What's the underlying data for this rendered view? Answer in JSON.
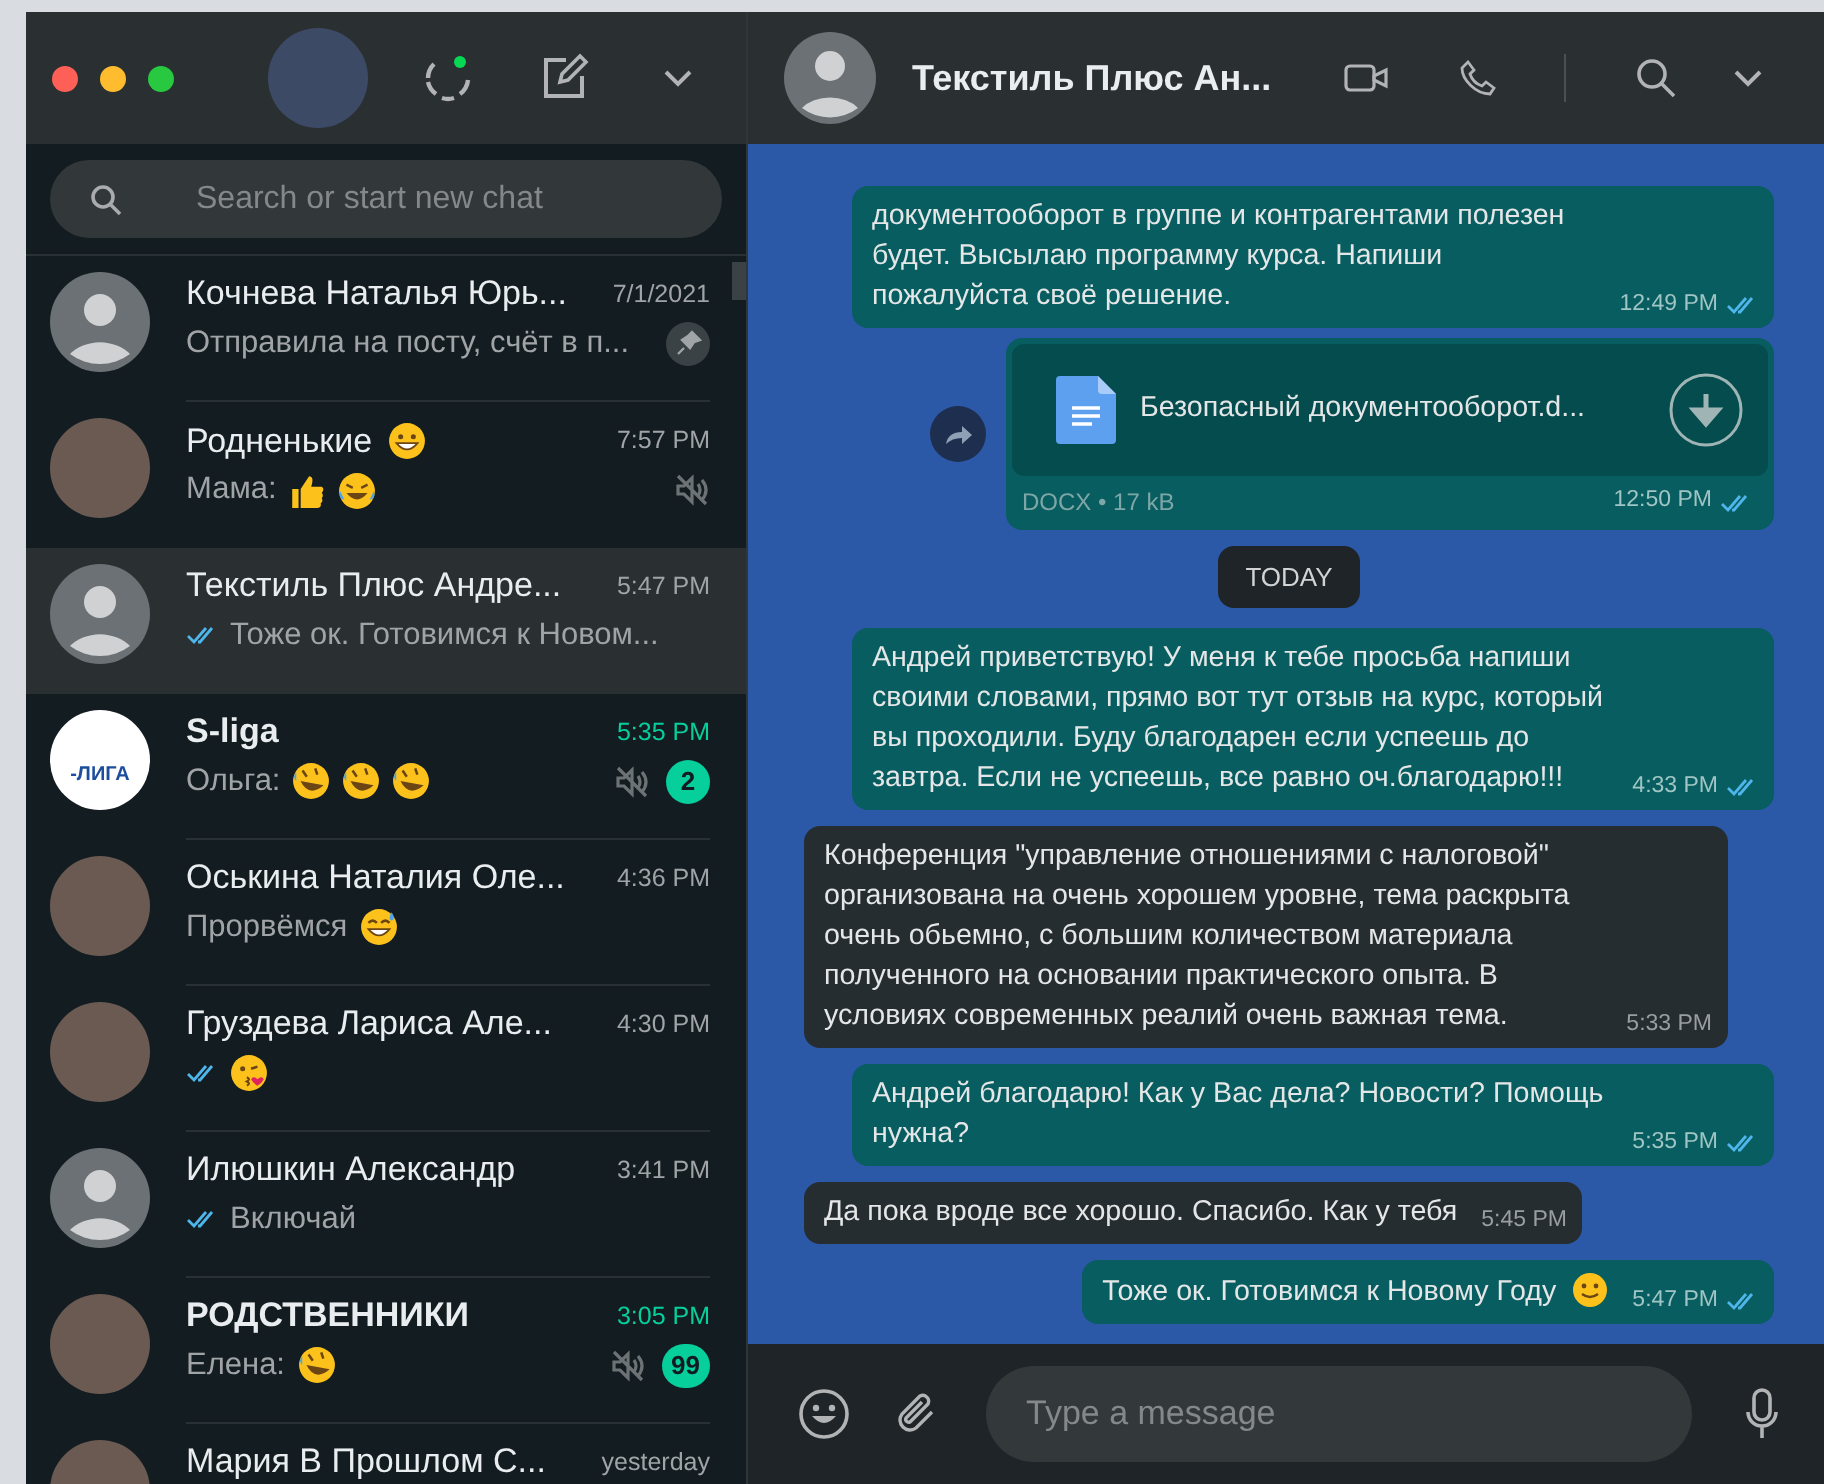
{
  "sidebar": {
    "search": {
      "placeholder": "Search or start new chat"
    },
    "chats": [
      {
        "name": "Кочнева Наталья Юрь...",
        "time": "7/1/2021",
        "preview": "Отправила на посту, счёт в п...",
        "avatar": {
          "kind": "default"
        },
        "pinned": true,
        "selected": false
      },
      {
        "name": "Родненькие",
        "name_emoji": [
          {
            "kind": "grin"
          }
        ],
        "time": "7:57 PM",
        "preview": "Мама:",
        "preview_emoji": [
          {
            "kind": "thumbs-up"
          },
          {
            "kind": "laughing"
          }
        ],
        "avatar": {
          "kind": "photo"
        },
        "muted": true,
        "selected": false
      },
      {
        "name": "Текстиль Плюс Андре...",
        "time": "5:47 PM",
        "preview": "Тоже ок. Готовимся к Новом...",
        "ticks": true,
        "avatar": {
          "kind": "default"
        },
        "selected": true
      },
      {
        "name": "S-liga",
        "time": "5:35 PM",
        "preview": "Ольга:",
        "preview_emoji": [
          {
            "kind": "rofl"
          },
          {
            "kind": "rofl"
          },
          {
            "kind": "rofl"
          }
        ],
        "avatar": {
          "kind": "logo",
          "text": "-ЛИГА"
        },
        "muted": true,
        "unread": "2",
        "selected": false
      },
      {
        "name": "Оськина Наталия Оле...",
        "time": "4:36 PM",
        "preview": "Прорвёмся",
        "preview_emoji": [
          {
            "kind": "sweat-smile"
          }
        ],
        "avatar": {
          "kind": "photo"
        },
        "selected": false
      },
      {
        "name": "Груздева Лариса Але...",
        "time": "4:30 PM",
        "ticks": true,
        "preview_emoji": [
          {
            "kind": "kiss"
          }
        ],
        "avatar": {
          "kind": "photo"
        },
        "selected": false
      },
      {
        "name": "Илюшкин Александр",
        "time": "3:41 PM",
        "preview": "Включай",
        "ticks": true,
        "avatar": {
          "kind": "default"
        },
        "selected": false
      },
      {
        "name": "РОДСТВЕННИКИ",
        "time": "3:05 PM",
        "preview": "Елена:",
        "preview_emoji": [
          {
            "kind": "rofl"
          }
        ],
        "avatar": {
          "kind": "photo"
        },
        "muted": true,
        "unread": "99",
        "selected": false
      },
      {
        "name": "Мария В Прошлом С...",
        "time": "yesterday",
        "avatar": {
          "kind": "photo"
        },
        "selected": false
      }
    ]
  },
  "chat": {
    "title": "Текстиль Плюс Ан...",
    "messages": [
      {
        "kind": "text",
        "outgoing": true,
        "text": "документооборот в группе и контрагентами полезен будет. Высылаю программу курса. Напиши пожалуйста своё решение.",
        "time": "12:49 PM",
        "ticks": true
      },
      {
        "kind": "file",
        "outgoing": true,
        "file_name": "Безопасный документооборот.d...",
        "meta": "DOCX • 17 kB",
        "time": "12:50 PM",
        "ticks": true
      },
      {
        "kind": "date",
        "text": "TODAY"
      },
      {
        "kind": "text",
        "outgoing": true,
        "text": "Андрей приветствую! У меня к тебе просьба напиши своими словами, прямо вот тут отзыв на курс, который вы проходили. Буду благодарен если успеешь до завтра. Если не успеешь, все равно оч.благодарю!!!",
        "time": "4:33 PM",
        "ticks": true
      },
      {
        "kind": "text",
        "outgoing": false,
        "text": "Конференция \"управление отношениями с налоговой\" организована на очень хорошем уровне, тема раскрыта очень обьемно, с большим количеством материала полученного на основании практического опыта. В условиях современных реалий очень важная тема.",
        "time": "5:33 PM"
      },
      {
        "kind": "text",
        "outgoing": true,
        "text": "Андрей благодарю! Как у Вас дела? Новости? Помощь нужна?",
        "time": "5:35 PM",
        "ticks": true
      },
      {
        "kind": "text",
        "outgoing": false,
        "text": "Да пока вроде все хорошо. Спасибо. Как у тебя",
        "time": "5:45 PM"
      },
      {
        "kind": "text",
        "outgoing": true,
        "text": "Тоже ок. Готовимся к Новому Году",
        "emoji": [
          {
            "kind": "slight-smile"
          }
        ],
        "time": "5:47 PM",
        "ticks": true
      }
    ],
    "composer": {
      "placeholder": "Type a message"
    }
  }
}
